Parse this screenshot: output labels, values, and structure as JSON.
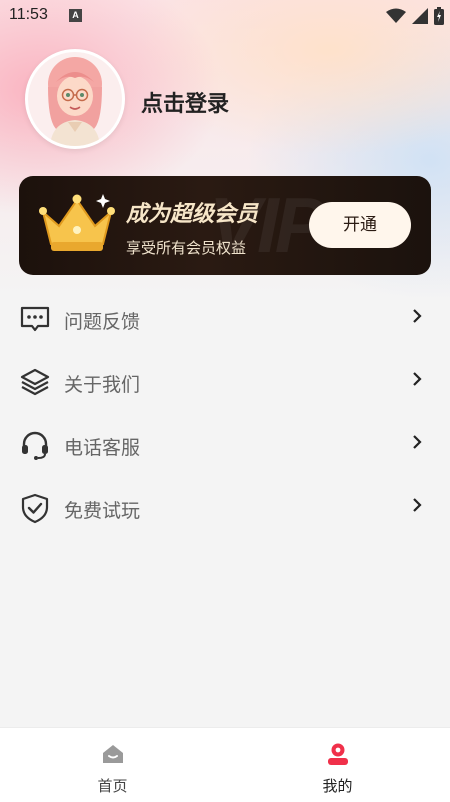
{
  "status_bar": {
    "time": "11:53",
    "app_badge": "A"
  },
  "profile": {
    "login_text": "点击登录"
  },
  "vip": {
    "watermark": "VIP",
    "title": "成为超级会员",
    "subtitle": "享受所有会员权益",
    "button_label": "开通"
  },
  "menu": {
    "items": [
      {
        "label": "问题反馈",
        "icon": "feedback-icon"
      },
      {
        "label": "关于我们",
        "icon": "layers-icon"
      },
      {
        "label": "电话客服",
        "icon": "headset-icon"
      },
      {
        "label": "免费试玩",
        "icon": "shield-check-icon"
      }
    ]
  },
  "tabbar": {
    "tabs": [
      {
        "label": "首页",
        "icon": "home-icon",
        "active": false
      },
      {
        "label": "我的",
        "icon": "profile-icon",
        "active": true
      }
    ]
  },
  "colors": {
    "accent": "#f0304a",
    "vip_gold": "#f7e6c8",
    "vip_bg": "#1c110c"
  }
}
